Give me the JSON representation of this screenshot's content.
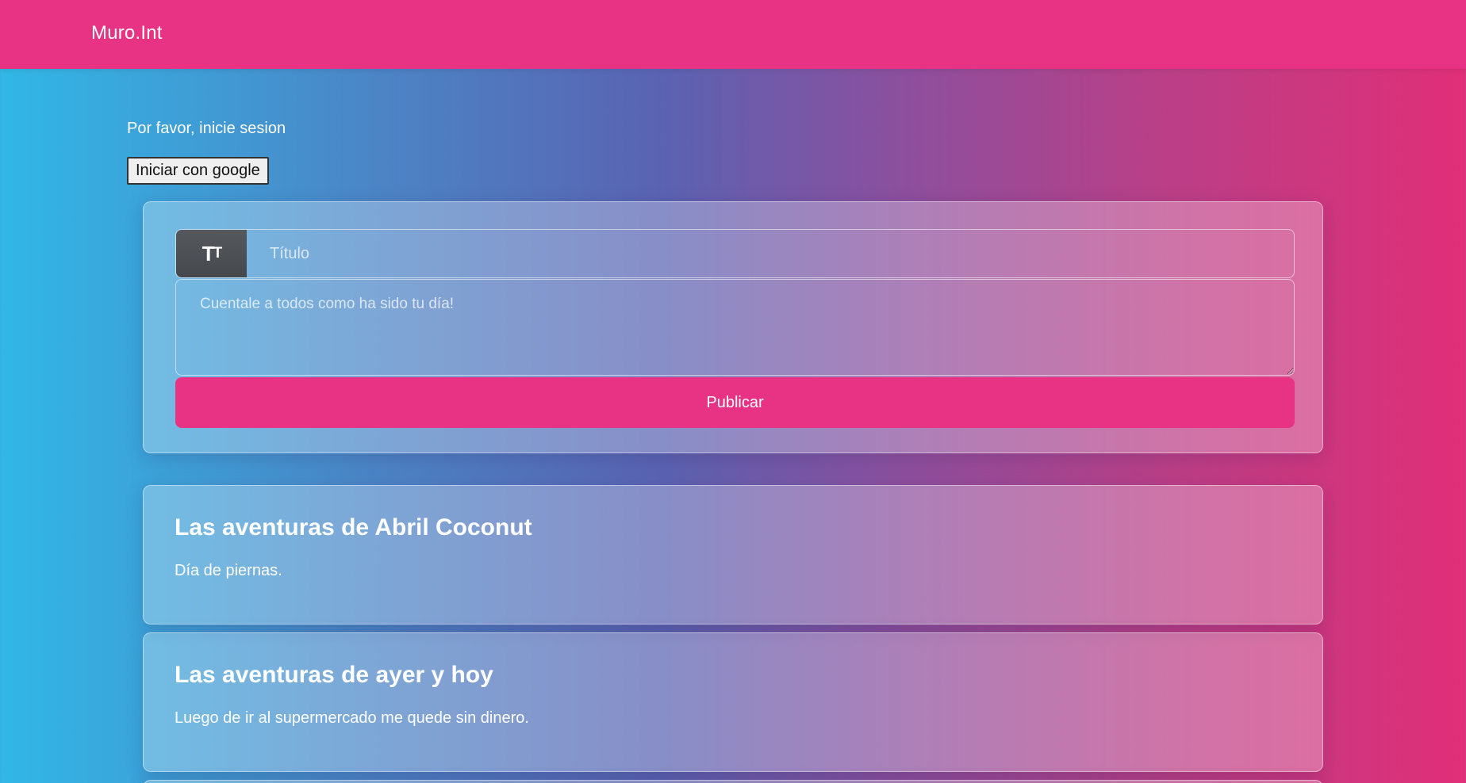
{
  "navbar": {
    "brand": "Muro.Int",
    "color": "#e83385"
  },
  "auth": {
    "prompt": "Por favor, inicie sesion",
    "google_button_label": "Iniciar con google"
  },
  "composer": {
    "title_icon": "text-size-icon",
    "title_icon_glyph_big": "T",
    "title_icon_glyph_small": "T",
    "title_placeholder": "Título",
    "body_placeholder": "Cuentale a todos como ha sido tu día!",
    "publish_label": "Publicar"
  },
  "posts": [
    {
      "title": "Las aventuras de Abril Coconut",
      "body": "Día de piernas."
    },
    {
      "title": "Las aventuras de ayer y hoy",
      "body": "Luego de ir al supermercado me quede sin dinero."
    }
  ],
  "colors": {
    "accent": "#e83385",
    "gradient_start": "#31b7e6",
    "gradient_end": "#e02f78"
  }
}
